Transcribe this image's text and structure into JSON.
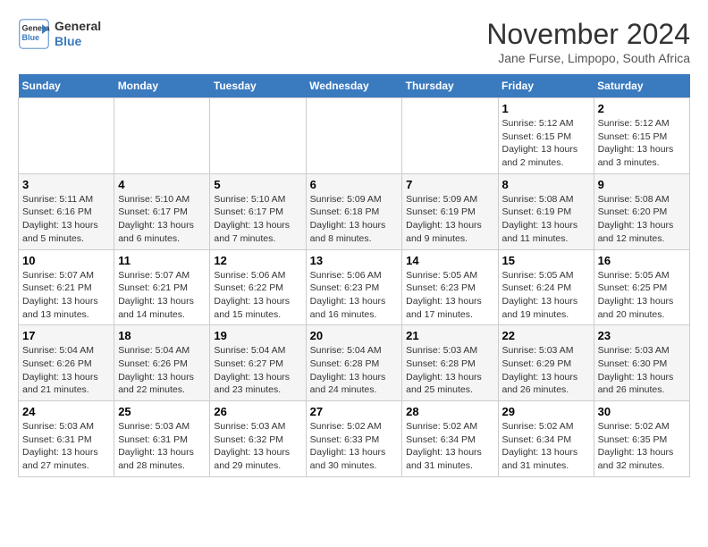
{
  "header": {
    "logo_line1": "General",
    "logo_line2": "Blue",
    "month": "November 2024",
    "subtitle": "Jane Furse, Limpopo, South Africa"
  },
  "weekdays": [
    "Sunday",
    "Monday",
    "Tuesday",
    "Wednesday",
    "Thursday",
    "Friday",
    "Saturday"
  ],
  "weeks": [
    [
      {
        "day": "",
        "info": ""
      },
      {
        "day": "",
        "info": ""
      },
      {
        "day": "",
        "info": ""
      },
      {
        "day": "",
        "info": ""
      },
      {
        "day": "",
        "info": ""
      },
      {
        "day": "1",
        "info": "Sunrise: 5:12 AM\nSunset: 6:15 PM\nDaylight: 13 hours\nand 2 minutes."
      },
      {
        "day": "2",
        "info": "Sunrise: 5:12 AM\nSunset: 6:15 PM\nDaylight: 13 hours\nand 3 minutes."
      }
    ],
    [
      {
        "day": "3",
        "info": "Sunrise: 5:11 AM\nSunset: 6:16 PM\nDaylight: 13 hours\nand 5 minutes."
      },
      {
        "day": "4",
        "info": "Sunrise: 5:10 AM\nSunset: 6:17 PM\nDaylight: 13 hours\nand 6 minutes."
      },
      {
        "day": "5",
        "info": "Sunrise: 5:10 AM\nSunset: 6:17 PM\nDaylight: 13 hours\nand 7 minutes."
      },
      {
        "day": "6",
        "info": "Sunrise: 5:09 AM\nSunset: 6:18 PM\nDaylight: 13 hours\nand 8 minutes."
      },
      {
        "day": "7",
        "info": "Sunrise: 5:09 AM\nSunset: 6:19 PM\nDaylight: 13 hours\nand 9 minutes."
      },
      {
        "day": "8",
        "info": "Sunrise: 5:08 AM\nSunset: 6:19 PM\nDaylight: 13 hours\nand 11 minutes."
      },
      {
        "day": "9",
        "info": "Sunrise: 5:08 AM\nSunset: 6:20 PM\nDaylight: 13 hours\nand 12 minutes."
      }
    ],
    [
      {
        "day": "10",
        "info": "Sunrise: 5:07 AM\nSunset: 6:21 PM\nDaylight: 13 hours\nand 13 minutes."
      },
      {
        "day": "11",
        "info": "Sunrise: 5:07 AM\nSunset: 6:21 PM\nDaylight: 13 hours\nand 14 minutes."
      },
      {
        "day": "12",
        "info": "Sunrise: 5:06 AM\nSunset: 6:22 PM\nDaylight: 13 hours\nand 15 minutes."
      },
      {
        "day": "13",
        "info": "Sunrise: 5:06 AM\nSunset: 6:23 PM\nDaylight: 13 hours\nand 16 minutes."
      },
      {
        "day": "14",
        "info": "Sunrise: 5:05 AM\nSunset: 6:23 PM\nDaylight: 13 hours\nand 17 minutes."
      },
      {
        "day": "15",
        "info": "Sunrise: 5:05 AM\nSunset: 6:24 PM\nDaylight: 13 hours\nand 19 minutes."
      },
      {
        "day": "16",
        "info": "Sunrise: 5:05 AM\nSunset: 6:25 PM\nDaylight: 13 hours\nand 20 minutes."
      }
    ],
    [
      {
        "day": "17",
        "info": "Sunrise: 5:04 AM\nSunset: 6:26 PM\nDaylight: 13 hours\nand 21 minutes."
      },
      {
        "day": "18",
        "info": "Sunrise: 5:04 AM\nSunset: 6:26 PM\nDaylight: 13 hours\nand 22 minutes."
      },
      {
        "day": "19",
        "info": "Sunrise: 5:04 AM\nSunset: 6:27 PM\nDaylight: 13 hours\nand 23 minutes."
      },
      {
        "day": "20",
        "info": "Sunrise: 5:04 AM\nSunset: 6:28 PM\nDaylight: 13 hours\nand 24 minutes."
      },
      {
        "day": "21",
        "info": "Sunrise: 5:03 AM\nSunset: 6:28 PM\nDaylight: 13 hours\nand 25 minutes."
      },
      {
        "day": "22",
        "info": "Sunrise: 5:03 AM\nSunset: 6:29 PM\nDaylight: 13 hours\nand 26 minutes."
      },
      {
        "day": "23",
        "info": "Sunrise: 5:03 AM\nSunset: 6:30 PM\nDaylight: 13 hours\nand 26 minutes."
      }
    ],
    [
      {
        "day": "24",
        "info": "Sunrise: 5:03 AM\nSunset: 6:31 PM\nDaylight: 13 hours\nand 27 minutes."
      },
      {
        "day": "25",
        "info": "Sunrise: 5:03 AM\nSunset: 6:31 PM\nDaylight: 13 hours\nand 28 minutes."
      },
      {
        "day": "26",
        "info": "Sunrise: 5:03 AM\nSunset: 6:32 PM\nDaylight: 13 hours\nand 29 minutes."
      },
      {
        "day": "27",
        "info": "Sunrise: 5:02 AM\nSunset: 6:33 PM\nDaylight: 13 hours\nand 30 minutes."
      },
      {
        "day": "28",
        "info": "Sunrise: 5:02 AM\nSunset: 6:34 PM\nDaylight: 13 hours\nand 31 minutes."
      },
      {
        "day": "29",
        "info": "Sunrise: 5:02 AM\nSunset: 6:34 PM\nDaylight: 13 hours\nand 31 minutes."
      },
      {
        "day": "30",
        "info": "Sunrise: 5:02 AM\nSunset: 6:35 PM\nDaylight: 13 hours\nand 32 minutes."
      }
    ]
  ]
}
